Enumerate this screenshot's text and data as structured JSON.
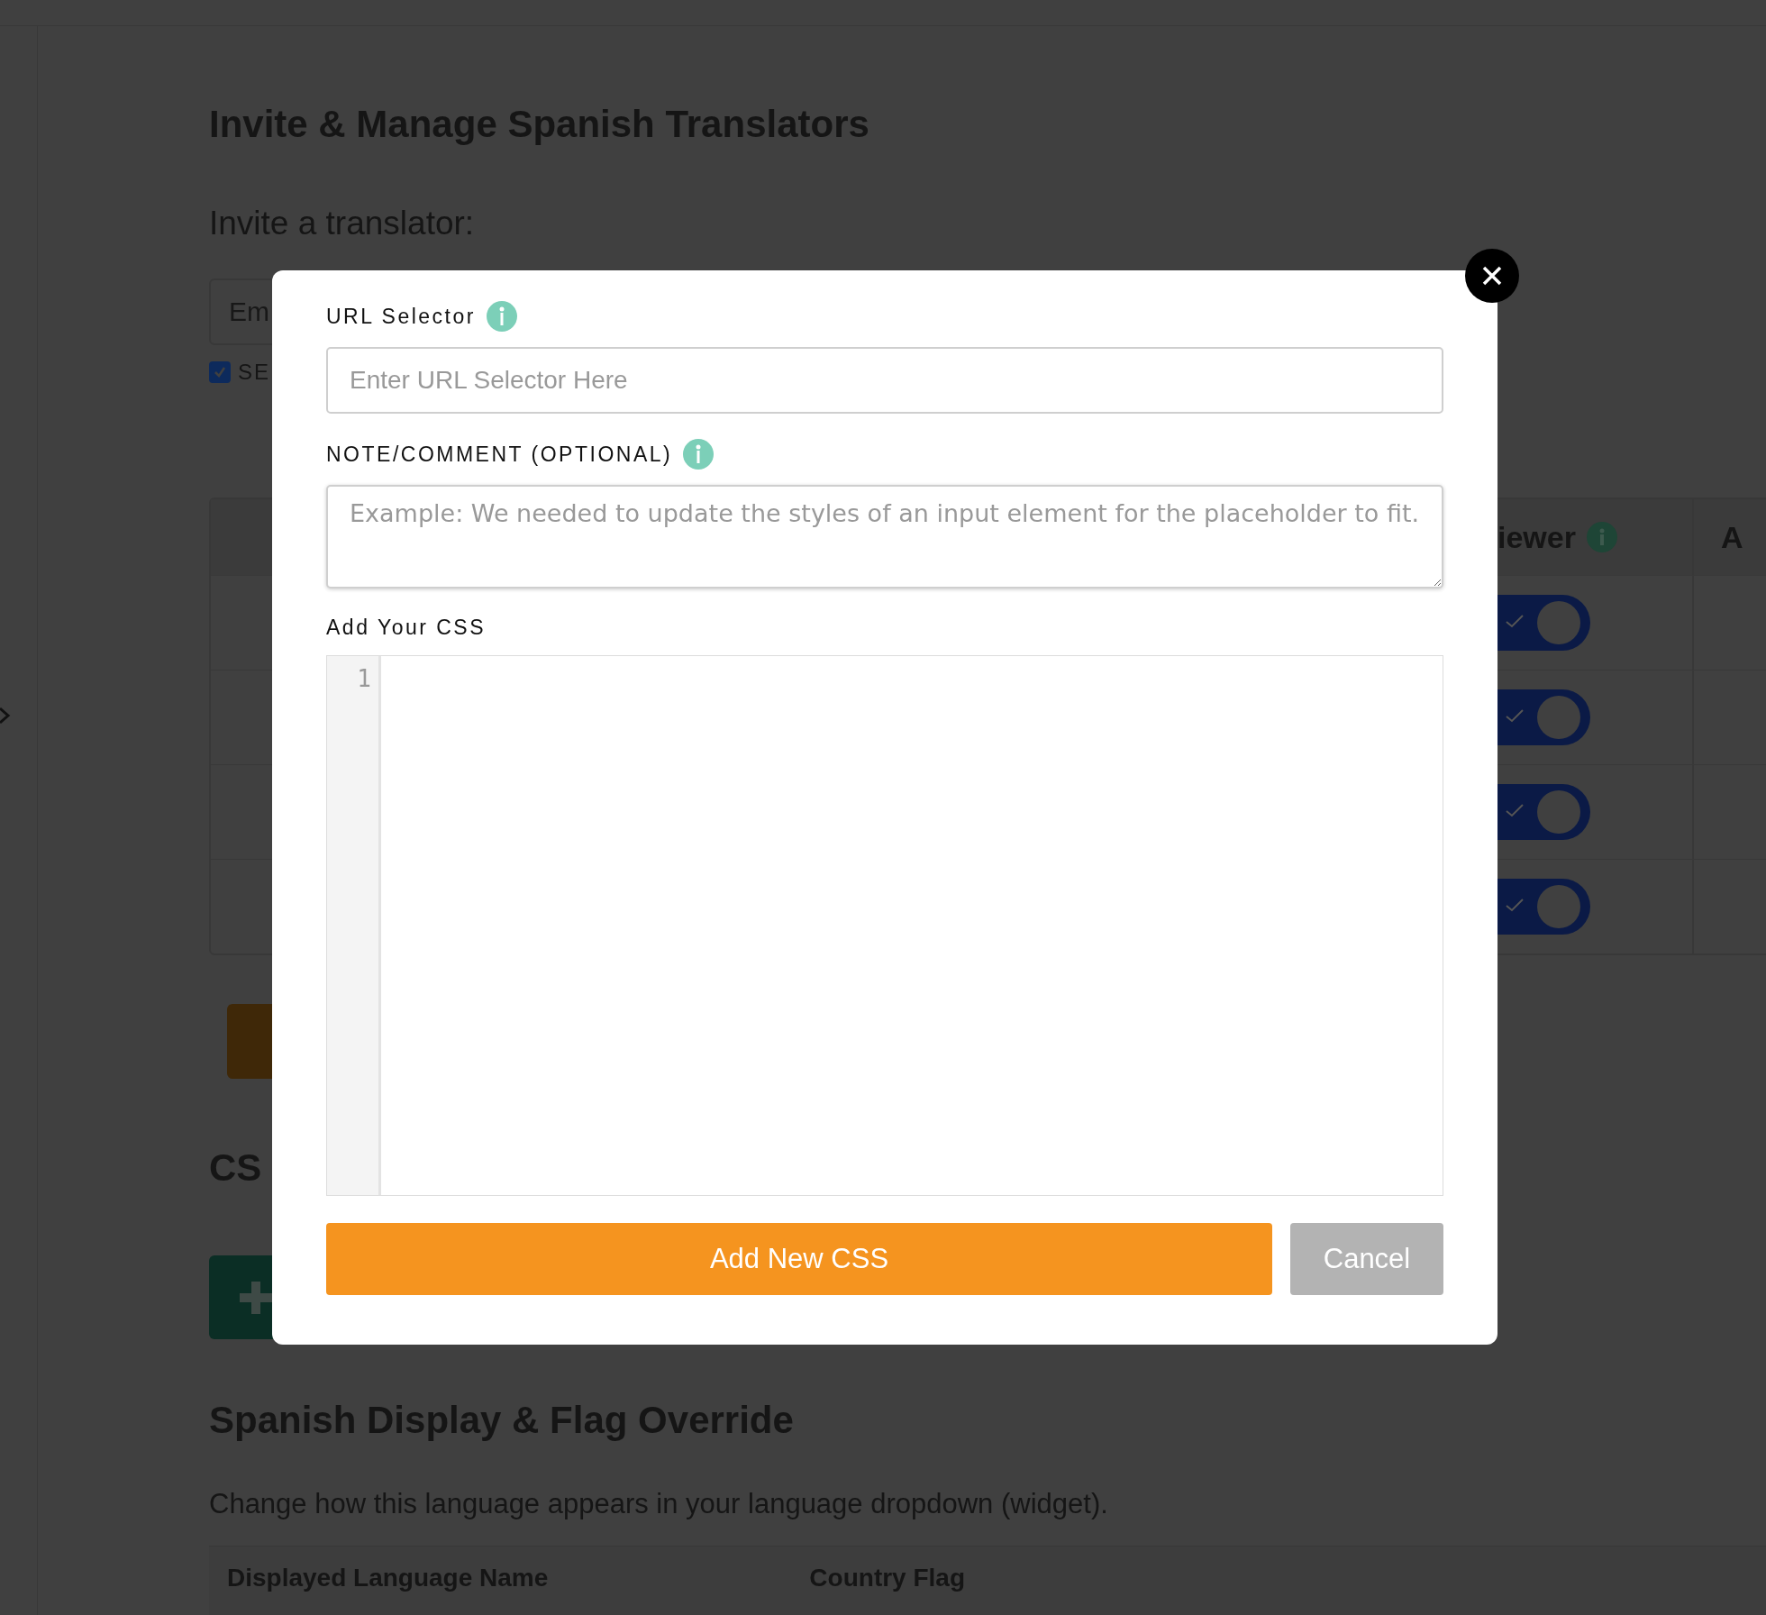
{
  "page": {
    "title": "Invite & Manage Spanish Translators",
    "invite_heading": "Invite a translator:",
    "email_placeholder": "Em",
    "checkbox": {
      "label": "SE",
      "checked": true
    },
    "table": {
      "columns": [
        "iewer",
        "A"
      ],
      "rows": [
        {
          "on": true
        },
        {
          "on": true
        },
        {
          "on": true
        },
        {
          "on": true
        }
      ]
    },
    "css_heading": "CS",
    "display_heading": "Spanish Display & Flag Override",
    "display_text": "Change how this language appears in your language dropdown (widget).",
    "display_table": {
      "columns": [
        "Displayed Language Name",
        "Country Flag"
      ]
    }
  },
  "modal": {
    "url_label": "URL Selector",
    "url_placeholder": "Enter URL Selector Here",
    "note_label": "NOTE/COMMENT (OPTIONAL)",
    "note_placeholder": "Example: We needed to update the styles of an input element for the placeholder to fit.",
    "css_label": "Add Your CSS",
    "line_numbers": [
      "1"
    ],
    "buttons": [
      {
        "label": "Add New CSS",
        "kind": "primary"
      },
      {
        "label": "Cancel",
        "kind": "secondary"
      }
    ]
  }
}
